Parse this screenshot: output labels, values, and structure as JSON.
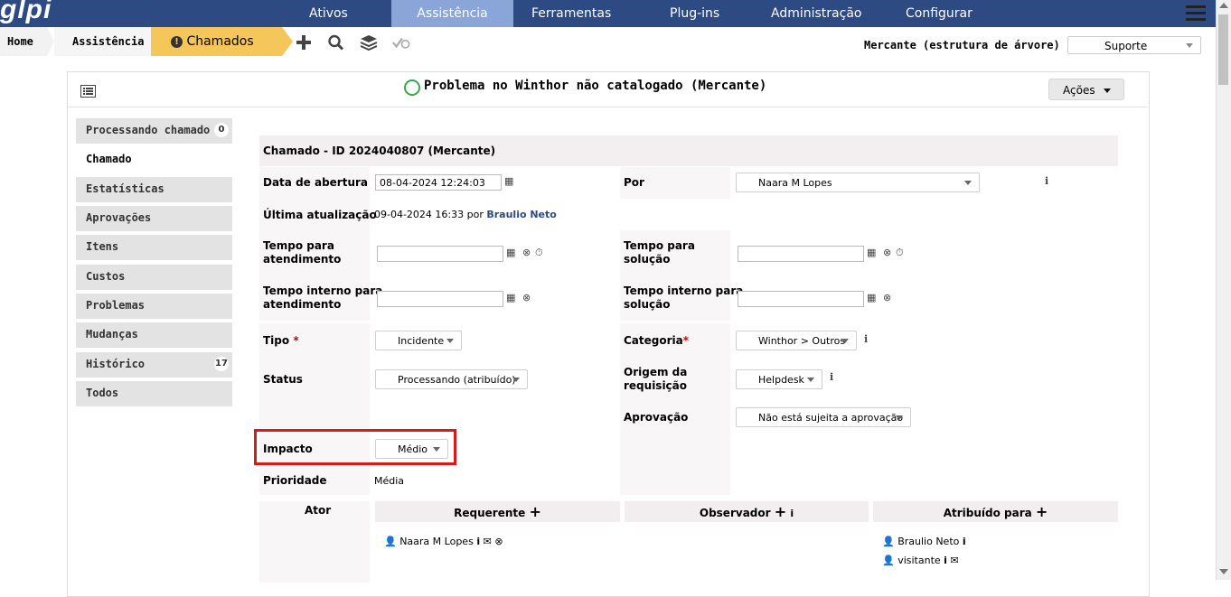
{
  "app": {
    "logo": "glpi"
  },
  "nav": {
    "items": [
      "Ativos",
      "Assistência",
      "Ferramentas",
      "Plug-ins",
      "Administração",
      "Configurar"
    ],
    "active": "Assistência"
  },
  "breadcrumb": {
    "home": "Home",
    "section": "Assistência",
    "current": "Chamados"
  },
  "entity": {
    "label": "Mercante (estrutura de árvore)",
    "profile": "Suporte"
  },
  "ticket": {
    "title": "Problema no Winthor não catalogado (Mercante)",
    "actions_label": "Ações",
    "header": "Chamado - ID 2024040807 (Mercante)"
  },
  "sidebar": {
    "items": [
      {
        "label": "Processando chamado",
        "badge": "0"
      },
      {
        "label": "Chamado",
        "badge": ""
      },
      {
        "label": "Estatísticas",
        "badge": ""
      },
      {
        "label": "Aprovações",
        "badge": ""
      },
      {
        "label": "Itens",
        "badge": ""
      },
      {
        "label": "Custos",
        "badge": ""
      },
      {
        "label": "Problemas",
        "badge": ""
      },
      {
        "label": "Mudanças",
        "badge": ""
      },
      {
        "label": "Histórico",
        "badge": "17"
      },
      {
        "label": "Todos",
        "badge": ""
      }
    ]
  },
  "form": {
    "open_date_label": "Data de abertura",
    "open_date_value": "08-04-2024 12:24:03",
    "by_label": "Por",
    "by_value": "Naara M Lopes",
    "last_update_label": "Última atualização",
    "last_update_value": "09-04-2024 16:33 por",
    "last_update_user": "Braulio Neto",
    "tta_label_1": "Tempo para",
    "tta_label_2": "atendimento",
    "ttr_label_1": "Tempo para",
    "ttr_label_2": "solução",
    "itta_label_1": "Tempo interno para",
    "itta_label_2": "atendimento",
    "ittr_label_1": "Tempo interno para",
    "ittr_label_2": "solução",
    "type_label": "Tipo",
    "type_value": "Incidente",
    "category_label": "Categoria",
    "category_value": "Winthor > Outros",
    "status_label": "Status",
    "status_value": "Processando (atribuído)",
    "origin_label_1": "Origem da",
    "origin_label_2": "requisição",
    "origin_value": "Helpdesk",
    "approval_label": "Aprovação",
    "approval_value": "Não está sujeita a aprovação",
    "impact_label": "Impacto",
    "impact_value": "Médio",
    "priority_label": "Prioridade",
    "priority_value": "Média"
  },
  "actors": {
    "actor_label": "Ator",
    "requester_label": "Requerente",
    "observer_label": "Observador",
    "assigned_label": "Atribuído para",
    "requester_user": "Naara M Lopes",
    "assigned_users": [
      "Braulio Neto",
      "visitante"
    ]
  },
  "colors": {
    "nav_bg": "#2d4a82",
    "nav_active": "#8aa5d8",
    "crumb_current": "#f5c75a",
    "highlight": "#d61b1b"
  }
}
